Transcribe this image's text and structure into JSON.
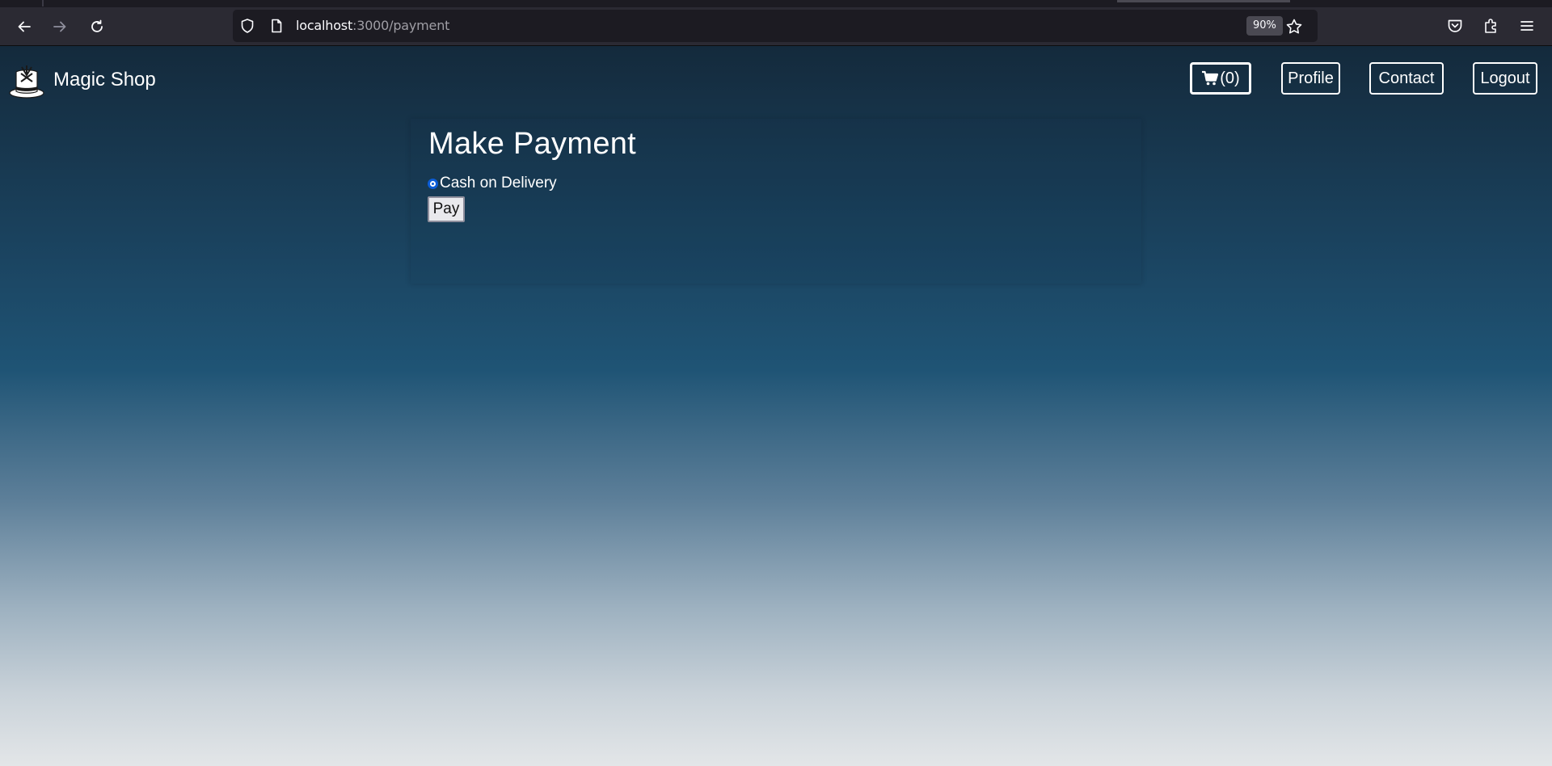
{
  "browser": {
    "url_host": "localhost",
    "url_rest": ":3000/payment",
    "zoom": "90%",
    "icons": [
      "back-arrow-icon",
      "forward-arrow-icon",
      "reload-icon",
      "shield-icon",
      "page-icon",
      "bookmark-star-icon",
      "pocket-icon",
      "extensions-icon",
      "menu-icon"
    ]
  },
  "header": {
    "brand": "Magic Shop",
    "cart_label": "(0)",
    "profile_label": "Profile",
    "contact_label": "Contact",
    "logout_label": "Logout"
  },
  "payment": {
    "title": "Make Payment",
    "option_label": "Cash on Delivery",
    "option_selected": true,
    "pay_label": "Pay"
  },
  "colors": {
    "page_gradient_top": "#142a3c",
    "page_gradient_mid": "#1f5475",
    "page_gradient_bottom": "#e3e6e8",
    "radio_accent": "#0b5cd6"
  }
}
